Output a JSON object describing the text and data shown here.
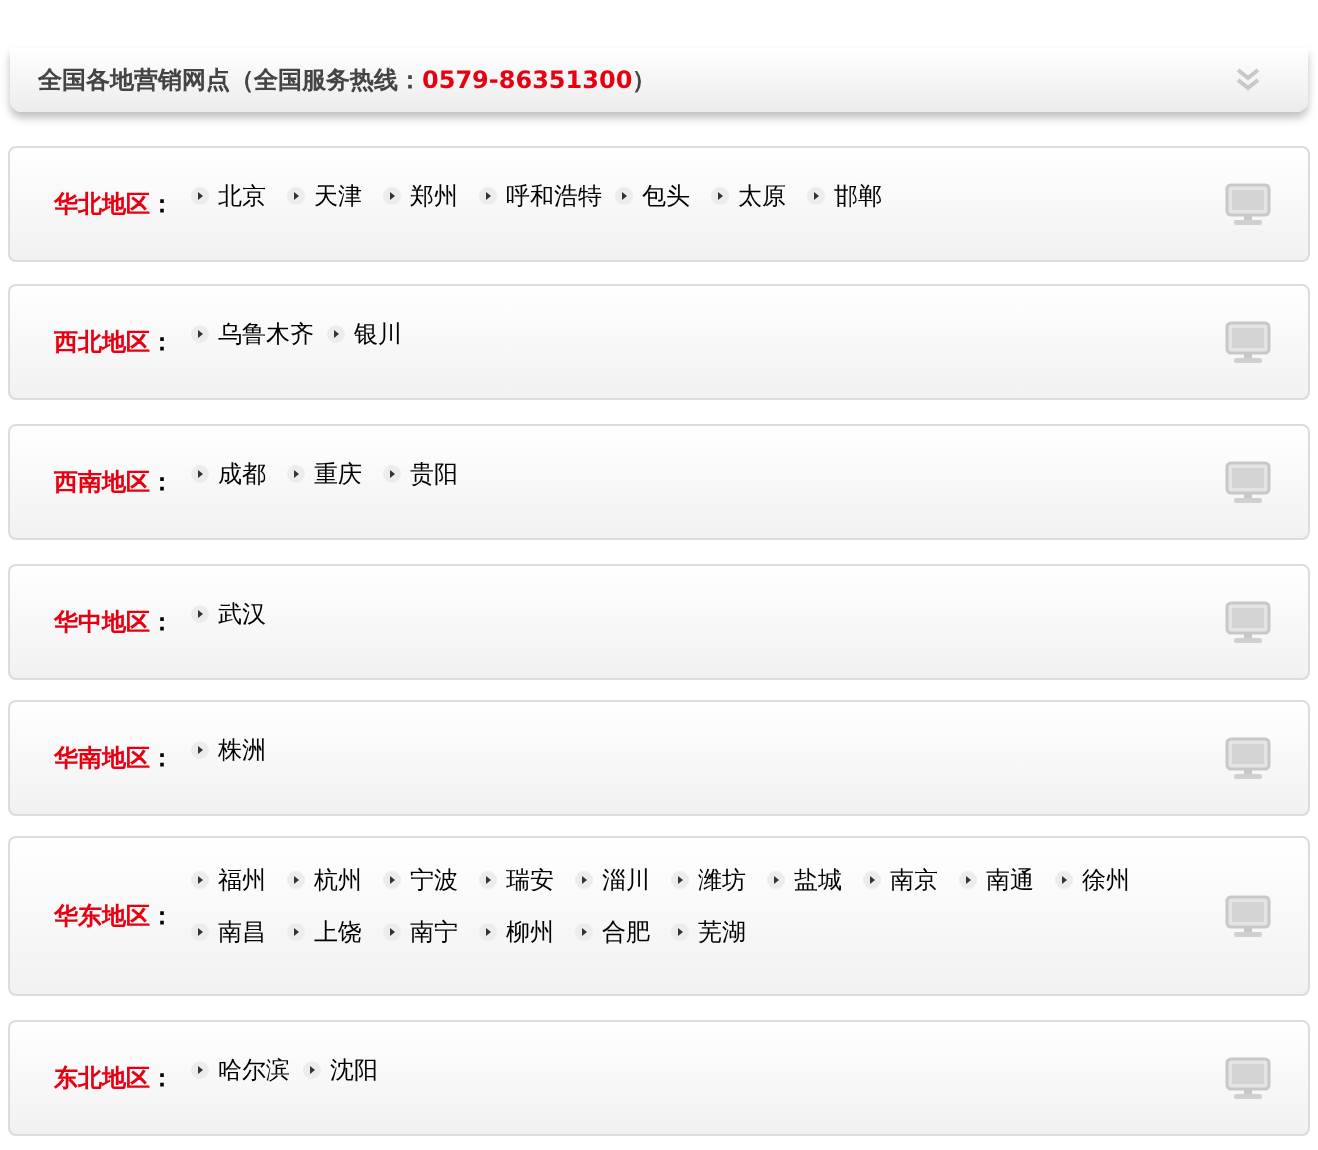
{
  "header": {
    "title": "全国各地营销网点（全国服务热线：",
    "hotline": "0579-86351300",
    "closing": "）"
  },
  "regions": [
    {
      "name": "华北地区",
      "colon": "：",
      "cities": [
        "北京",
        "天津",
        "郑州",
        "呼和浩特",
        "包头",
        "太原",
        "邯郸"
      ]
    },
    {
      "name": "西北地区",
      "colon": "：",
      "cities": [
        "乌鲁木齐",
        "银川"
      ]
    },
    {
      "name": "西南地区",
      "colon": "：",
      "cities": [
        "成都",
        "重庆",
        "贵阳"
      ]
    },
    {
      "name": "华中地区",
      "colon": "：",
      "cities": [
        "武汉"
      ]
    },
    {
      "name": "华南地区",
      "colon": "：",
      "cities": [
        "株洲"
      ]
    },
    {
      "name": "华东地区",
      "colon": "：",
      "cities": [
        "福州",
        "杭州",
        "宁波",
        "瑞安",
        "淄川",
        "潍坊",
        "盐城",
        "南京",
        "南通",
        "徐州",
        "南昌",
        "上饶",
        "南宁",
        "柳州",
        "合肥",
        "芜湖"
      ]
    },
    {
      "name": "东北地区",
      "colon": "：",
      "cities": [
        "哈尔滨",
        "沈阳"
      ]
    }
  ]
}
